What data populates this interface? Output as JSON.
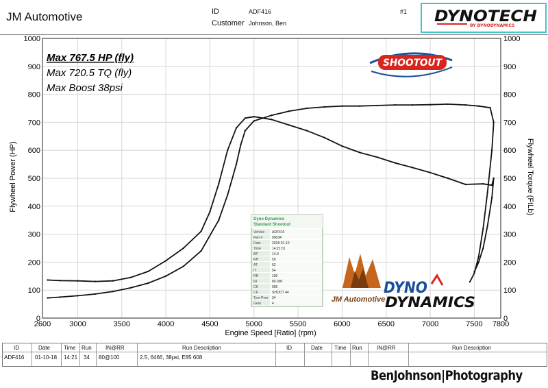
{
  "header": {
    "company": "JM Automotive",
    "id_label": "ID",
    "id_value": "ADF416",
    "customer_label": "Customer",
    "customer_value": "Johnson, Ben",
    "run_no": "#1"
  },
  "logos": {
    "dynotech_main": "DYNOTECH",
    "dynotech_sub": "BY DYNODYNAMICS",
    "shootout": "SHOOTOUT",
    "jm": "JM Automotive",
    "dyno_line1": "DYNO",
    "dyno_line2": "DYNAMICS"
  },
  "chart_data": {
    "type": "line",
    "annotations": [
      "Max 767.5 HP (fly)",
      "Max 720.5 TQ (fly)",
      "Max Boost 38psi"
    ],
    "xlabel": "Engine Speed [Ratio] (rpm)",
    "ylabel_left": "Flywheel Power (HP)",
    "ylabel_right": "Flywheel Torque (FtLb)",
    "xlim": [
      2600,
      7800
    ],
    "ylim": [
      0,
      1000
    ],
    "xticks": [
      2600,
      3000,
      3500,
      4000,
      4500,
      5000,
      5500,
      6000,
      6500,
      7000,
      7500,
      7800
    ],
    "yticks": [
      0,
      100,
      200,
      300,
      400,
      500,
      600,
      700,
      800,
      900,
      1000
    ],
    "grid": true,
    "series": [
      {
        "role": "power",
        "x": [
          2660,
          2800,
          3000,
          3200,
          3400,
          3600,
          3800,
          4000,
          4200,
          4400,
          4600,
          4700,
          4800,
          4850,
          4900,
          5000,
          5200,
          5400,
          5600,
          5800,
          6000,
          6200,
          6400,
          6600,
          6800,
          7000,
          7200,
          7400,
          7550,
          7680,
          7720,
          7700,
          7650,
          7600,
          7550,
          7500,
          7450
        ],
        "y": [
          72,
          75,
          80,
          86,
          95,
          108,
          125,
          150,
          185,
          240,
          350,
          440,
          550,
          620,
          670,
          705,
          725,
          740,
          750,
          755,
          758,
          758,
          760,
          762,
          762,
          763,
          765,
          762,
          758,
          752,
          700,
          600,
          450,
          320,
          220,
          160,
          130
        ]
      },
      {
        "role": "torque",
        "x": [
          2660,
          2800,
          3000,
          3200,
          3400,
          3600,
          3800,
          4000,
          4200,
          4400,
          4500,
          4600,
          4700,
          4800,
          4900,
          5000,
          5200,
          5400,
          5600,
          5800,
          6000,
          6200,
          6400,
          6600,
          6800,
          7000,
          7200,
          7400,
          7600,
          7700,
          7720,
          7700,
          7650,
          7600,
          7550,
          7500
        ],
        "y": [
          136,
          134,
          133,
          131,
          133,
          145,
          167,
          205,
          250,
          310,
          380,
          480,
          600,
          680,
          715,
          720,
          710,
          690,
          670,
          645,
          615,
          592,
          575,
          555,
          538,
          520,
          500,
          478,
          480,
          475,
          500,
          430,
          330,
          250,
          200,
          165
        ]
      }
    ]
  },
  "info_box": {
    "title1": "Dyno Dynamics",
    "title2": "Standard Shootout",
    "rows": [
      [
        "Vehicle",
        "ADF416"
      ],
      [
        "Run #",
        "00034"
      ],
      [
        "Date",
        "2018-01-10"
      ],
      [
        "Time",
        "14:21:01"
      ],
      [
        "BP",
        "14.0"
      ],
      [
        "RH",
        "59"
      ],
      [
        "AT",
        "52"
      ],
      [
        "IT",
        "54"
      ],
      [
        "RR",
        "100"
      ],
      [
        "IN",
        "80.000"
      ],
      [
        "CK",
        "905"
      ],
      [
        "CF",
        "SHOOT 44"
      ],
      [
        "Tyre Pres",
        "34"
      ],
      [
        "Gear",
        "4"
      ]
    ]
  },
  "table": {
    "headers": [
      "ID",
      "Date",
      "Time",
      "Run",
      "IN@RR",
      "Run Description",
      "ID",
      "Date",
      "Time",
      "Run",
      "IN@RR",
      "Run Description"
    ],
    "row": [
      "ADF416",
      "01-10-18",
      "14:21",
      "34",
      "80@100",
      "2.5, 6466, 38psi, E85 608"
    ]
  },
  "watermark": "BenJohnson|Photography",
  "colors": {
    "line": "#111111",
    "grid": "#d6d6d6",
    "info_header": "#2f9a4a",
    "info_row": "#e5efe5",
    "logo_red": "#d8261f",
    "logo_blue": "#1b4f9c",
    "accent_cyan": "#3fc6cf",
    "jm_orange": "#c6651c"
  }
}
